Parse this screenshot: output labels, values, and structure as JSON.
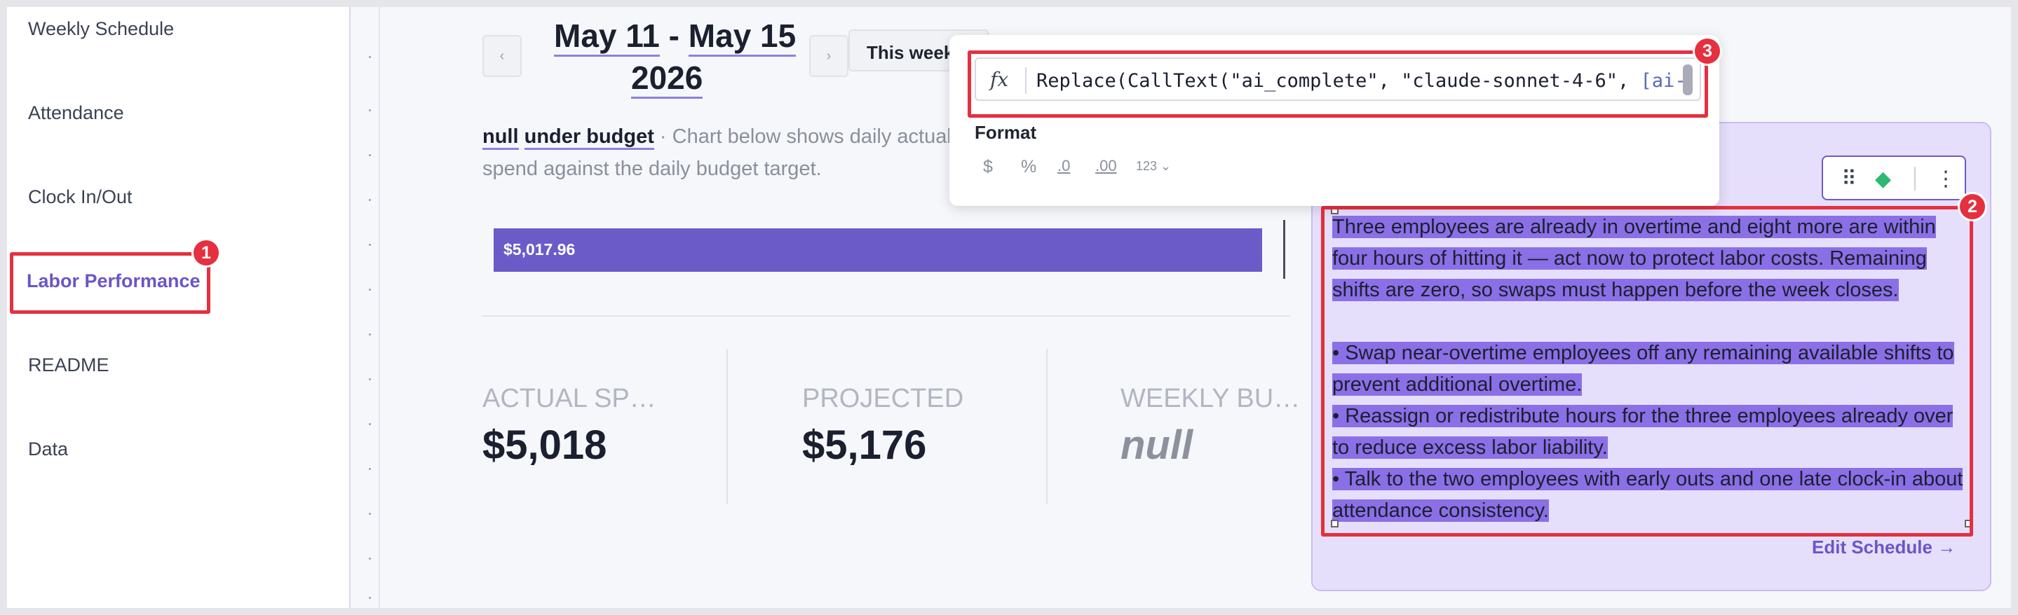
{
  "sidebar": {
    "items": [
      {
        "label": "Weekly Schedule",
        "active": false
      },
      {
        "label": "Attendance",
        "active": false
      },
      {
        "label": "Clock In/Out",
        "active": false
      },
      {
        "label": "Labor Performance",
        "active": true
      },
      {
        "label": "README",
        "active": false
      },
      {
        "label": "Data",
        "active": false
      }
    ]
  },
  "header": {
    "date_range_start": "May 11",
    "date_range_sep": " - ",
    "date_range_end": "May 15",
    "year": "2026",
    "prev_icon": "chevron-left-icon",
    "next_icon": "chevron-right-icon",
    "this_week_label": "This week"
  },
  "summary": {
    "status_null": "null",
    "status_text": "under budget",
    "description": " · Chart below shows daily actual spend against the daily budget target."
  },
  "chart": {
    "bar_label": "$5,017.96"
  },
  "kpis": [
    {
      "label": "ACTUAL SP…",
      "value": "$5,018"
    },
    {
      "label": "PROJECTED",
      "value": "$5,176"
    },
    {
      "label": "WEEKLY BU…",
      "value": "null"
    }
  ],
  "ai_panel": {
    "paragraphs": [
      "Three employees are already in overtime and eight more are within four hours of hitting it — act now to protect labor costs. Remaining shifts are zero, so swaps must happen before the week closes.",
      "",
      "• Swap near-overtime employees off any remaining available shifts to prevent additional overtime.",
      "• Reassign or redistribute hours for the three employees already over to reduce excess labor liability.",
      "• Talk to the two employees with early outs and one late clock-in about attendance consistency."
    ],
    "edit_link": "Edit Schedule →",
    "toolbar_icons": [
      "drag-handle-icon",
      "sparkle-icon",
      "more-vertical-icon"
    ]
  },
  "formula": {
    "fx_label": "fx",
    "text": "Replace(CallText(\"ai_complete\", \"claude-sonnet-4-6\", ",
    "text_more": "[ai-",
    "format_label": "Format",
    "format_icons": [
      {
        "name": "currency-icon",
        "glyph": "$"
      },
      {
        "name": "percent-icon",
        "glyph": "%"
      },
      {
        "name": "decrease-decimals-icon",
        "glyph": ".0"
      },
      {
        "name": "increase-decimals-icon",
        "glyph": ".00"
      },
      {
        "name": "number-format-icon",
        "glyph": "123"
      }
    ]
  },
  "annotations": {
    "badge1": "1",
    "badge2": "2",
    "badge3": "3",
    "color": "#e5303f"
  },
  "colors": {
    "accent": "#6b55c8",
    "bar": "#6b5bc9",
    "panel_bg": "#e6dffb",
    "highlight": "#8b6fe6"
  }
}
